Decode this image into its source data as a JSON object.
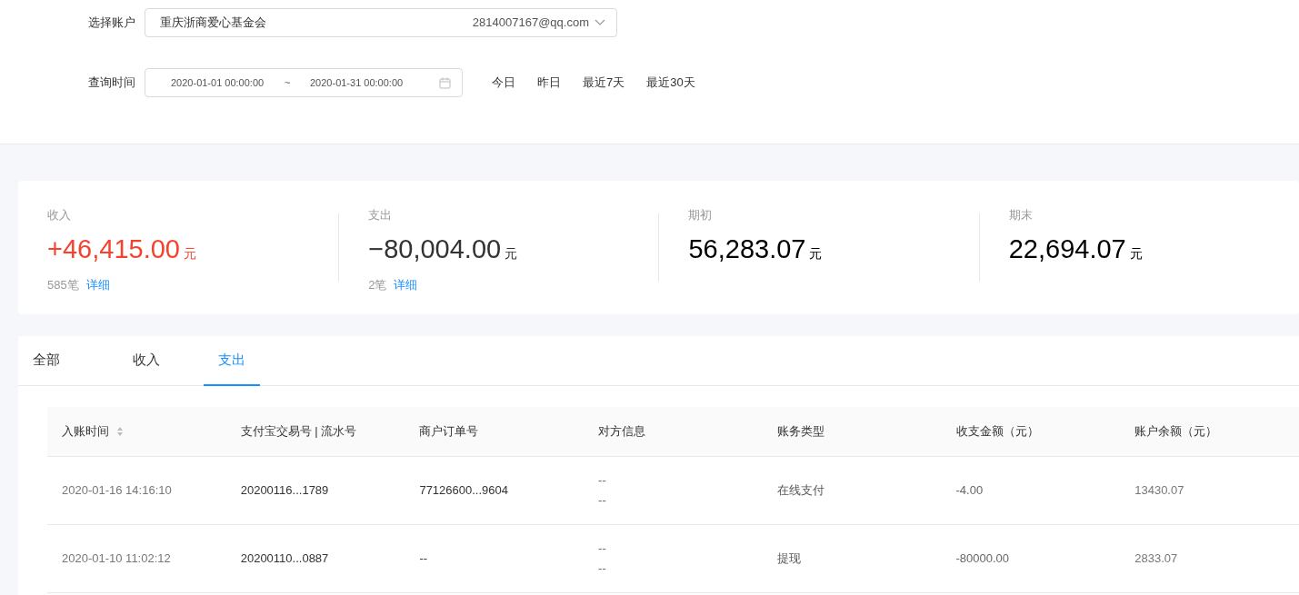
{
  "account_select": {
    "label": "选择账户",
    "name": "重庆浙商爱心基金会",
    "email": "2814007167@qq.com"
  },
  "query_time": {
    "label": "查询时间",
    "start": "2020-01-01 00:00:00",
    "separator": "~",
    "end": "2020-01-31 00:00:00"
  },
  "quick_ranges": [
    "今日",
    "昨日",
    "最近7天",
    "最近30天"
  ],
  "stats": [
    {
      "label": "收入",
      "amount": "+46,415.00",
      "unit": "元",
      "color": "#f5422f",
      "count": "585笔",
      "link": "详细"
    },
    {
      "label": "支出",
      "amount": "−80,004.00",
      "unit": "元",
      "color": "#333333",
      "count": "2笔",
      "link": "详细"
    },
    {
      "label": "期初",
      "amount": "56,283.07",
      "unit": "元",
      "color": "#000000"
    },
    {
      "label": "期末",
      "amount": "22,694.07",
      "unit": "元",
      "color": "#000000"
    }
  ],
  "tabs": [
    {
      "label": "全部",
      "selected": false
    },
    {
      "label": "收入",
      "selected": false
    },
    {
      "label": "支出",
      "selected": true
    }
  ],
  "table": {
    "columns": [
      {
        "label": "入账时间",
        "sortable": true
      },
      {
        "label": "支付宝交易号 | 流水号",
        "sortable": false
      },
      {
        "label": "商户订单号",
        "sortable": false
      },
      {
        "label": "对方信息",
        "sortable": false
      },
      {
        "label": "账务类型",
        "sortable": false
      },
      {
        "label": "收支金额（元）",
        "sortable": false
      },
      {
        "label": "账户余额（元）",
        "sortable": false
      }
    ],
    "rows": [
      {
        "time": "2020-01-16 14:16:10",
        "trade_no": "20200116...1789",
        "order_no": "77126600...9604",
        "counterparty": [
          "--",
          "--"
        ],
        "type": "在线支付",
        "amount": "-4.00",
        "balance": "13430.07"
      },
      {
        "time": "2020-01-10 11:02:12",
        "trade_no": "20200110...0887",
        "order_no": "--",
        "counterparty": [
          "--",
          "--"
        ],
        "type": "提现",
        "amount": "-80000.00",
        "balance": "2833.07"
      }
    ]
  }
}
